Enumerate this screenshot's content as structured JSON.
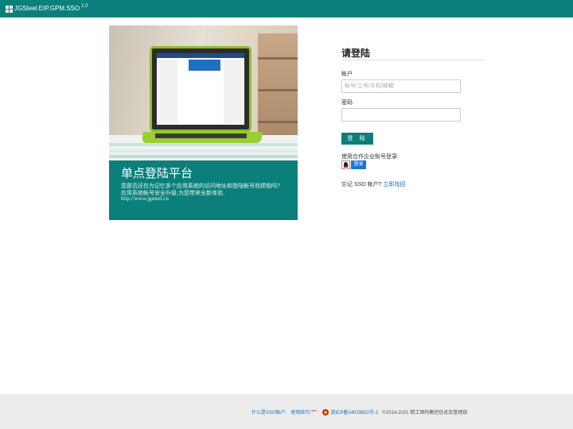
{
  "header": {
    "app_title": "JGSteel.EIP.GPM.SSO",
    "version": "1.0"
  },
  "hero": {
    "title": "单点登陆平台",
    "line1": "您是否还在为记忆多个应用系统的访问地址和登陆帐号而烦恼吗?",
    "line2": "应用系统帐号安全升级,为您带来全新体验.",
    "url": "http://www.jgsteel.cn"
  },
  "login": {
    "heading": "请登陆",
    "account_label": "帐户",
    "account_placeholder": "帐号/工号/手机/邮箱",
    "password_label": "密码",
    "login_button": "登 陆",
    "partner_label": "使用合作企业账号登录:",
    "qq_button": "登录",
    "forgot_text": "忘记 SSO 帐户?",
    "forgot_link": "立即找回"
  },
  "footer": {
    "what_is_sso": "什么是SSO帐户",
    "tips": "使用技巧",
    "new_badge": "new",
    "icp": "浙ICP备14029822号-1",
    "copyright": "©2014-2021 精工钢构集团信息及管理部"
  },
  "colors": {
    "brand": "#0b7f7a",
    "link": "#1a6fb5"
  }
}
